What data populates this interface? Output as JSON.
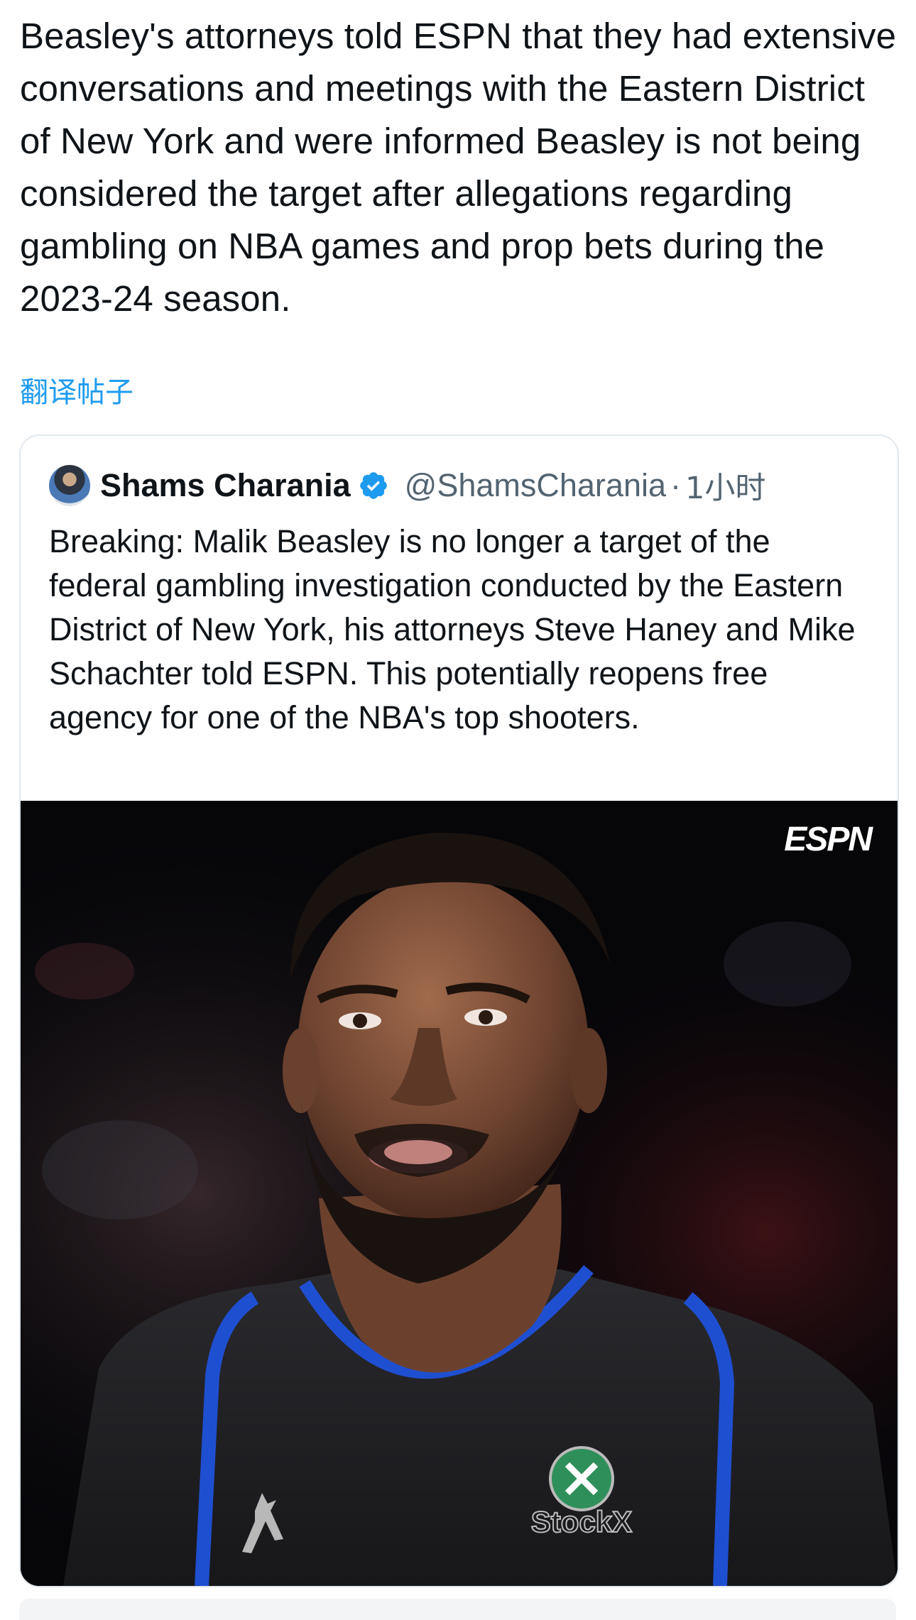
{
  "post": {
    "text": "Beasley's attorneys told ESPN that they had extensive conversations and meetings with the Eastern District of New York and were informed Beasley is not being considered the target after allegations regarding gambling on NBA games and prop bets during the 2023-24 season.",
    "translate_label": "翻译帖子"
  },
  "quoted_post": {
    "author_name": "Shams Charania",
    "handle": "@ShamsCharania",
    "separator": "·",
    "time": "1小时",
    "text": "Breaking: Malik Beasley is no longer a target of the federal gambling investigation conducted by the Eastern District of New York, his attorneys Steve Haney and Mike Schachter told ESPN. This potentially reopens free agency for one of the NBA's top shooters.",
    "media": {
      "watermark": "ESPN",
      "jersey_logo": "StockX"
    }
  },
  "colors": {
    "link": "#1d9bf0",
    "secondary_text": "#536471",
    "verified": "#1d9bf0",
    "jersey_trim": "#1f4fd1"
  }
}
